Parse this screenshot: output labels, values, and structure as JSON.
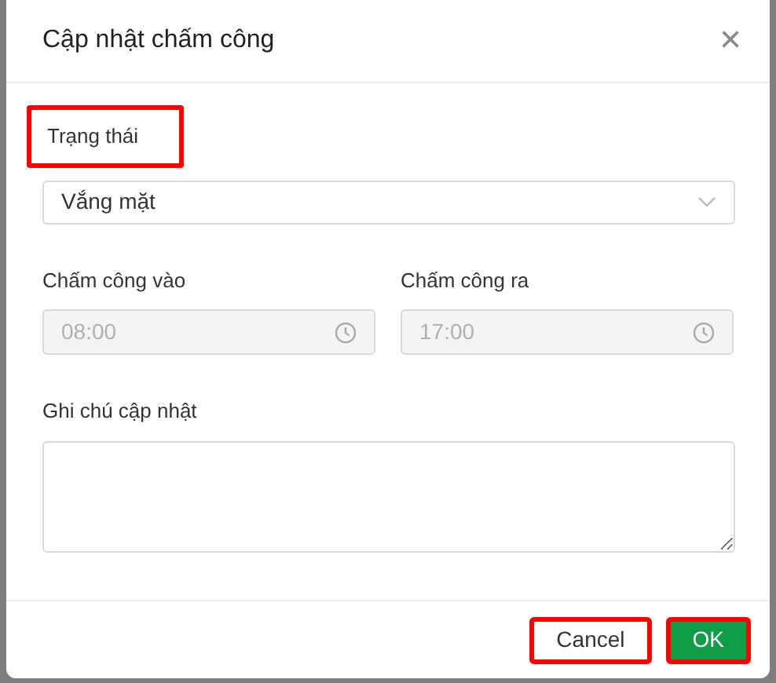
{
  "dialog": {
    "title": "Cập nhật chấm công",
    "close": "×"
  },
  "status": {
    "label": "Trạng thái",
    "highlighted": true,
    "value": "Vắng mặt"
  },
  "times": [
    {
      "label": "Chấm công vào",
      "value": "08:00",
      "disabled": true
    },
    {
      "label": "Chấm công ra",
      "value": "17:00",
      "disabled": true
    }
  ],
  "note": {
    "label": "Ghi chú cập nhật"
  },
  "buttons": [
    {
      "label": "Cancel",
      "kind": "secondary",
      "highlighted": true
    },
    {
      "label": "OK",
      "kind": "primary",
      "highlighted": true
    }
  ]
}
